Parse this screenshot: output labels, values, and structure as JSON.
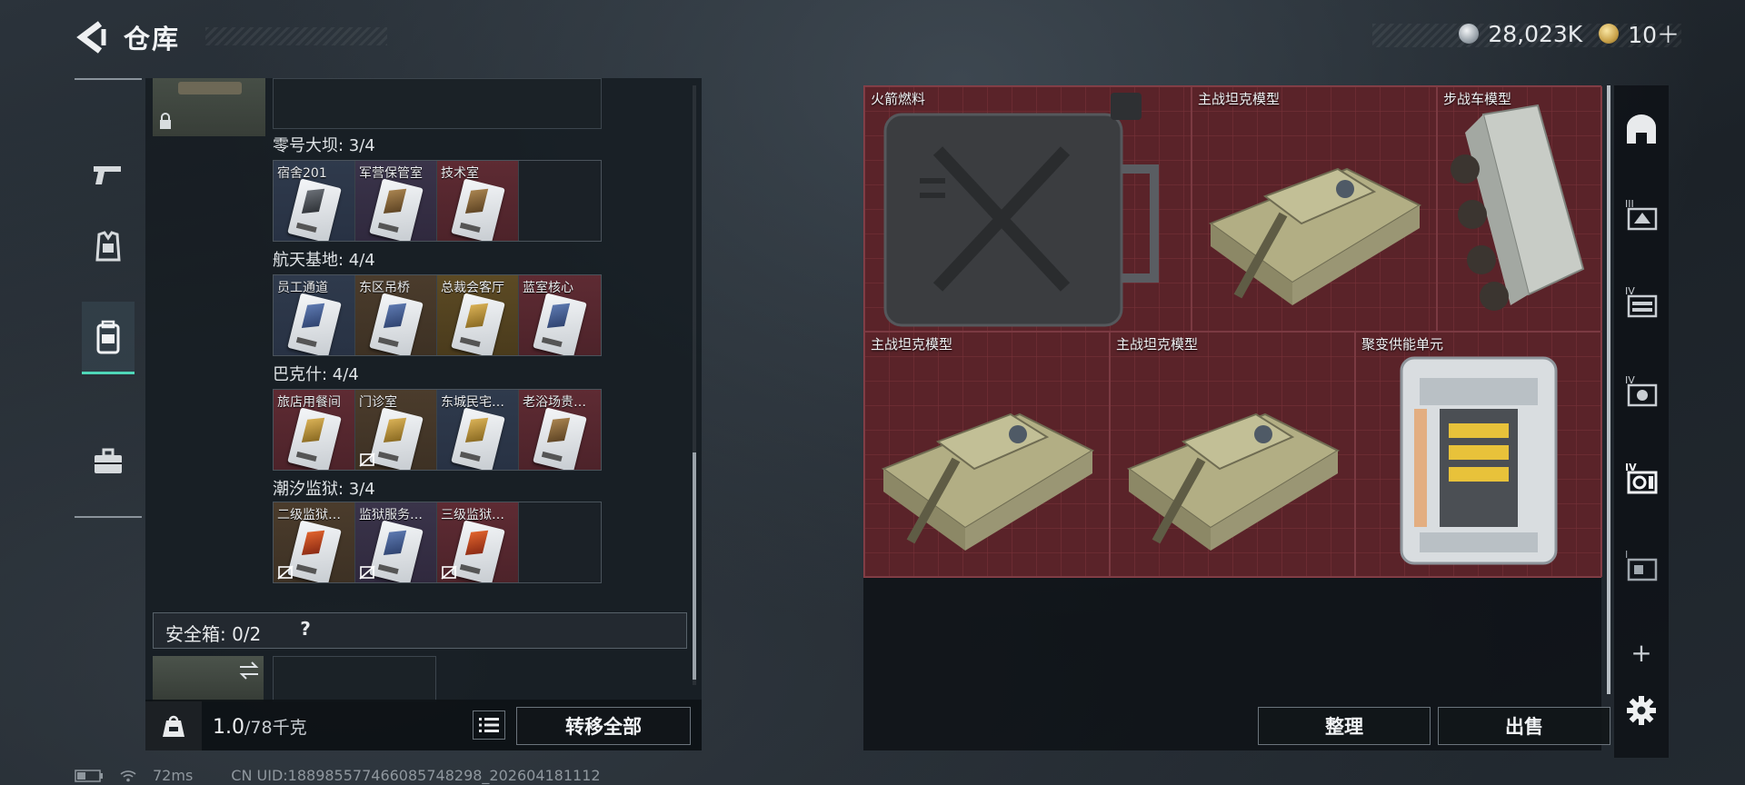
{
  "header": {
    "title": "仓库",
    "currency_1": "28,023K",
    "currency_2": "10＋"
  },
  "left_rail": {
    "items": [
      {
        "icon": "gun-icon"
      },
      {
        "icon": "armor-vest-icon"
      },
      {
        "icon": "backpack-icon",
        "active": true
      },
      {
        "icon": "briefcase-icon"
      }
    ]
  },
  "keycard_groups": [
    {
      "title": "零号大坝: 3/4",
      "slots": [
        {
          "label": "宿舍201",
          "rarity": "blue"
        },
        {
          "label": "军营保管室",
          "rarity": "purple"
        },
        {
          "label": "技术室",
          "rarity": "red"
        },
        {
          "label": "",
          "rarity": "dark"
        }
      ]
    },
    {
      "title": "航天基地: 4/4",
      "slots": [
        {
          "label": "员工通道",
          "rarity": "blue"
        },
        {
          "label": "东区吊桥",
          "rarity": "brown"
        },
        {
          "label": "总裁会客厅",
          "rarity": "gold"
        },
        {
          "label": "蓝室核心",
          "rarity": "red"
        }
      ]
    },
    {
      "title": "巴克什: 4/4",
      "slots": [
        {
          "label": "旅店用餐间",
          "rarity": "red"
        },
        {
          "label": "门诊室",
          "rarity": "brown",
          "no_trade": true
        },
        {
          "label": "东城民宅…",
          "rarity": "blue"
        },
        {
          "label": "老浴场贵…",
          "rarity": "red"
        }
      ]
    },
    {
      "title": "潮汐监狱: 3/4",
      "slots": [
        {
          "label": "二级监狱…",
          "rarity": "brown",
          "no_trade": true
        },
        {
          "label": "监狱服务…",
          "rarity": "purple",
          "no_trade": true
        },
        {
          "label": "三级监狱…",
          "rarity": "red",
          "no_trade": true
        },
        {
          "label": "",
          "rarity": "dark"
        }
      ]
    }
  ],
  "safebox": {
    "label": "安全箱: 0/2",
    "help": "?"
  },
  "bottom_left": {
    "weight": "1.0",
    "capacity": "/78千克",
    "transfer_all": "转移全部"
  },
  "stash": {
    "items": [
      {
        "name": "火箭燃料"
      },
      {
        "name": "主战坦克模型"
      },
      {
        "name": "步战车模型"
      },
      {
        "name": "主战坦克模型"
      },
      {
        "name": "主战坦克模型"
      },
      {
        "name": "聚变供能单元"
      }
    ],
    "sort": "整理",
    "sell": "出售"
  },
  "right_rail": {
    "items": [
      {
        "icon": "stash-arch-icon"
      },
      {
        "icon": "container-tier-3-icon"
      },
      {
        "icon": "container-tier-4a-icon"
      },
      {
        "icon": "container-tier-4b-icon"
      },
      {
        "icon": "container-tier-4c-icon"
      },
      {
        "icon": "container-tier-1-icon"
      },
      {
        "icon": "plus-icon",
        "label": "+"
      },
      {
        "icon": "gear-icon"
      }
    ]
  },
  "status": {
    "ping": "72ms",
    "uid": "CN UID:1889855774660857482​98_202604181112"
  },
  "colors": {
    "accent": "#4fd7b8",
    "stash_bg": "#5a2329"
  }
}
